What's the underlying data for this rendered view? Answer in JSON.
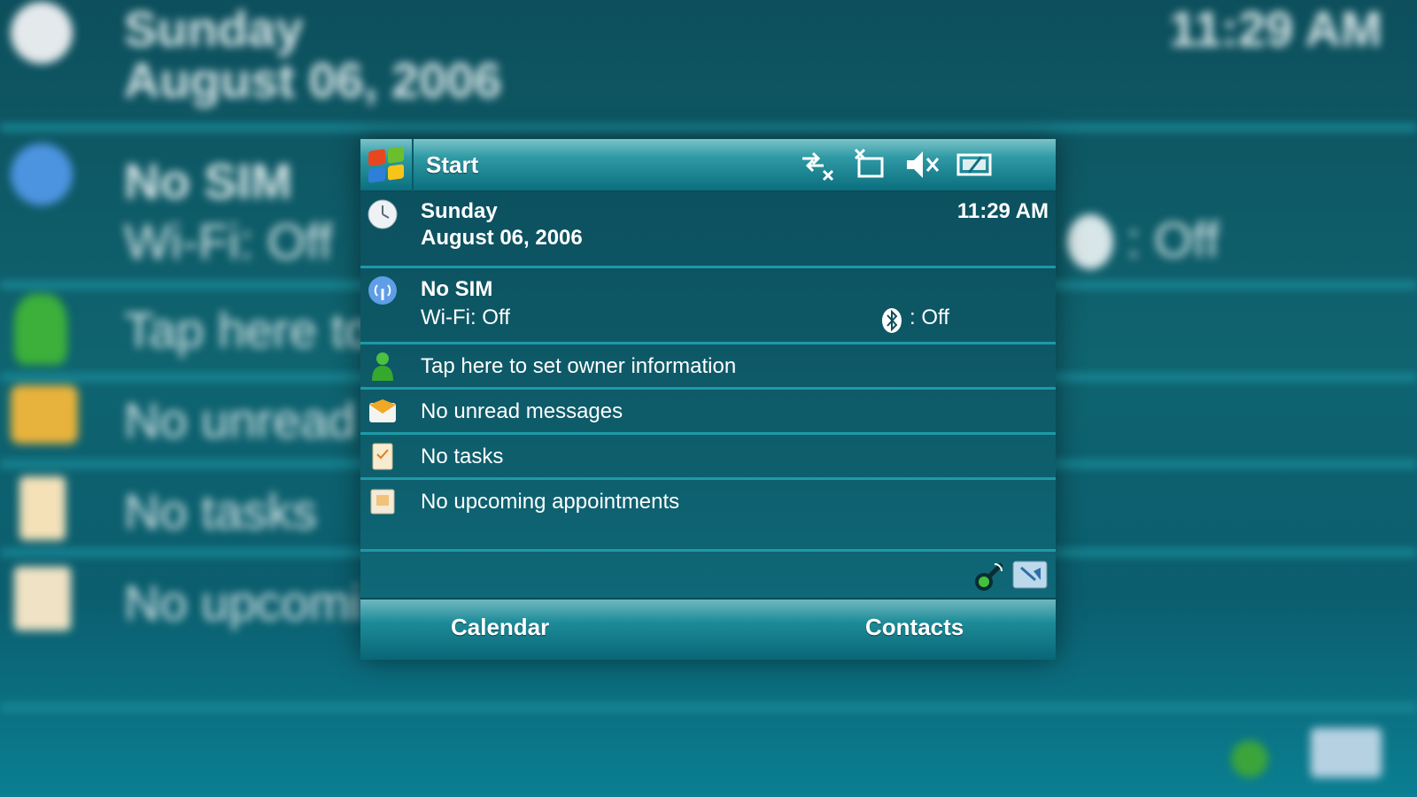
{
  "background": {
    "day": "Sunday",
    "date": "August 06, 2006",
    "time": "11:29 AM",
    "network": "No SIM",
    "wifi": "Wi-Fi: Off",
    "bluetooth_status": ": Off",
    "owner_partial": "Tap here to",
    "messages_partial": "No unread",
    "tasks": "No tasks",
    "appointments_partial": "No upcomi"
  },
  "titlebar": {
    "start_label": "Start",
    "status_icons": [
      "connectivity-icon",
      "sync-icon",
      "volume-muted-icon",
      "battery-icon"
    ]
  },
  "today": {
    "date": {
      "day": "Sunday",
      "date": "August 06, 2006",
      "time": "11:29 AM",
      "icon": "clock-icon"
    },
    "network": {
      "carrier": "No SIM",
      "wifi": "Wi-Fi: Off",
      "bluetooth_status": ": Off",
      "icon": "signal-icon"
    },
    "owner": {
      "label": "Tap here to set owner information",
      "icon": "owner-icon"
    },
    "messages": {
      "label": "No unread messages",
      "icon": "mail-icon"
    },
    "tasks": {
      "label": "No tasks",
      "icon": "tasks-icon"
    },
    "appointments": {
      "label": "No upcoming appointments",
      "icon": "calendar-icon"
    }
  },
  "tray": {
    "icons": [
      "comm-manager-icon",
      "display-icon"
    ]
  },
  "softkeys": {
    "left": "Calendar",
    "right": "Contacts"
  },
  "colors": {
    "accent": "#1d9aa8",
    "background": "#0e5c6a",
    "text": "#ffffff"
  }
}
